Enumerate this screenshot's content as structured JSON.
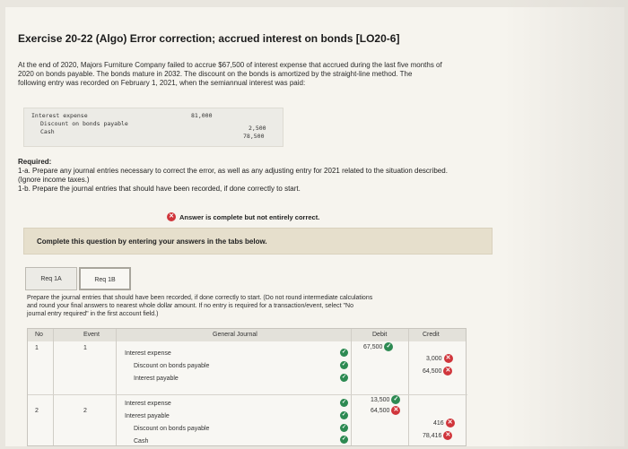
{
  "exercise": {
    "title": "Exercise 20-22 (Algo) Error correction; accrued interest on bonds [LO20-6]",
    "intro_lines": [
      "At the end of 2020, Majors Furniture Company failed to accrue $67,500 of interest expense that accrued during the last five months of",
      "2020 on bonds payable. The bonds mature in 2032. The discount on the bonds is amortized by the straight-line method. The",
      "following entry was recorded on February 1, 2021, when the semiannual interest was paid:"
    ]
  },
  "original_entry": {
    "rows": [
      {
        "account": "Interest expense",
        "debit": "81,000",
        "credit": ""
      },
      {
        "account": "Discount on bonds payable",
        "debit": "",
        "credit": "2,500"
      },
      {
        "account": "Cash",
        "debit": "",
        "credit": "78,500"
      }
    ]
  },
  "required": {
    "heading": "Required:",
    "line1": "1-a. Prepare any journal entries necessary to correct the error, as well as any adjusting entry for 2021 related to the situation described.",
    "line2": "(Ignore income taxes.)",
    "line3": "1-b. Prepare the journal entries that should have been recorded, if done correctly to start."
  },
  "banner": {
    "text": "Answer is complete but not entirely correct."
  },
  "complete_box": {
    "text": "Complete this question by entering your answers in the tabs below."
  },
  "tabs": [
    {
      "label": "Req 1A",
      "active": false
    },
    {
      "label": "Req 1B",
      "active": true
    }
  ],
  "instructions": {
    "lines": [
      "Prepare the journal entries that should have been recorded, if done correctly to start. (Do not round intermediate calculations",
      "and round your final answers to nearest whole dollar amount. If no entry is required for a transaction/event, select \"No",
      "journal entry required\" in the first account field.)"
    ]
  },
  "journal": {
    "headers": {
      "no": "No",
      "event": "Event",
      "general_journal": "General Journal",
      "debit": "Debit",
      "credit": "Credit"
    },
    "rows": [
      {
        "no": "1",
        "event": "1",
        "account": "Interest expense",
        "debit": "67,500",
        "debit_status": "correct",
        "credit": "",
        "credit_status": ""
      },
      {
        "no": "",
        "event": "",
        "account": "Discount on bonds payable",
        "debit": "",
        "debit_status": "",
        "credit": "3,000",
        "credit_status": "incorrect"
      },
      {
        "no": "",
        "event": "",
        "account": "Interest payable",
        "debit": "",
        "debit_status": "",
        "credit": "64,500",
        "credit_status": "incorrect"
      },
      {
        "no": "2",
        "event": "2",
        "account": "Interest expense",
        "debit": "13,500",
        "debit_status": "correct",
        "credit": "",
        "credit_status": ""
      },
      {
        "no": "",
        "event": "",
        "account": "Interest payable",
        "debit": "64,500",
        "debit_status": "incorrect",
        "credit": "",
        "credit_status": ""
      },
      {
        "no": "",
        "event": "",
        "account": "Discount on bonds payable",
        "debit": "",
        "debit_status": "",
        "credit": "416",
        "credit_status": "incorrect"
      },
      {
        "no": "",
        "event": "",
        "account": "Cash",
        "debit": "",
        "debit_status": "",
        "credit": "78,416",
        "credit_status": "incorrect"
      }
    ]
  },
  "colors": {
    "correct": "#2d8a52",
    "incorrect": "#d0353b",
    "box": "#e6dfcc"
  }
}
